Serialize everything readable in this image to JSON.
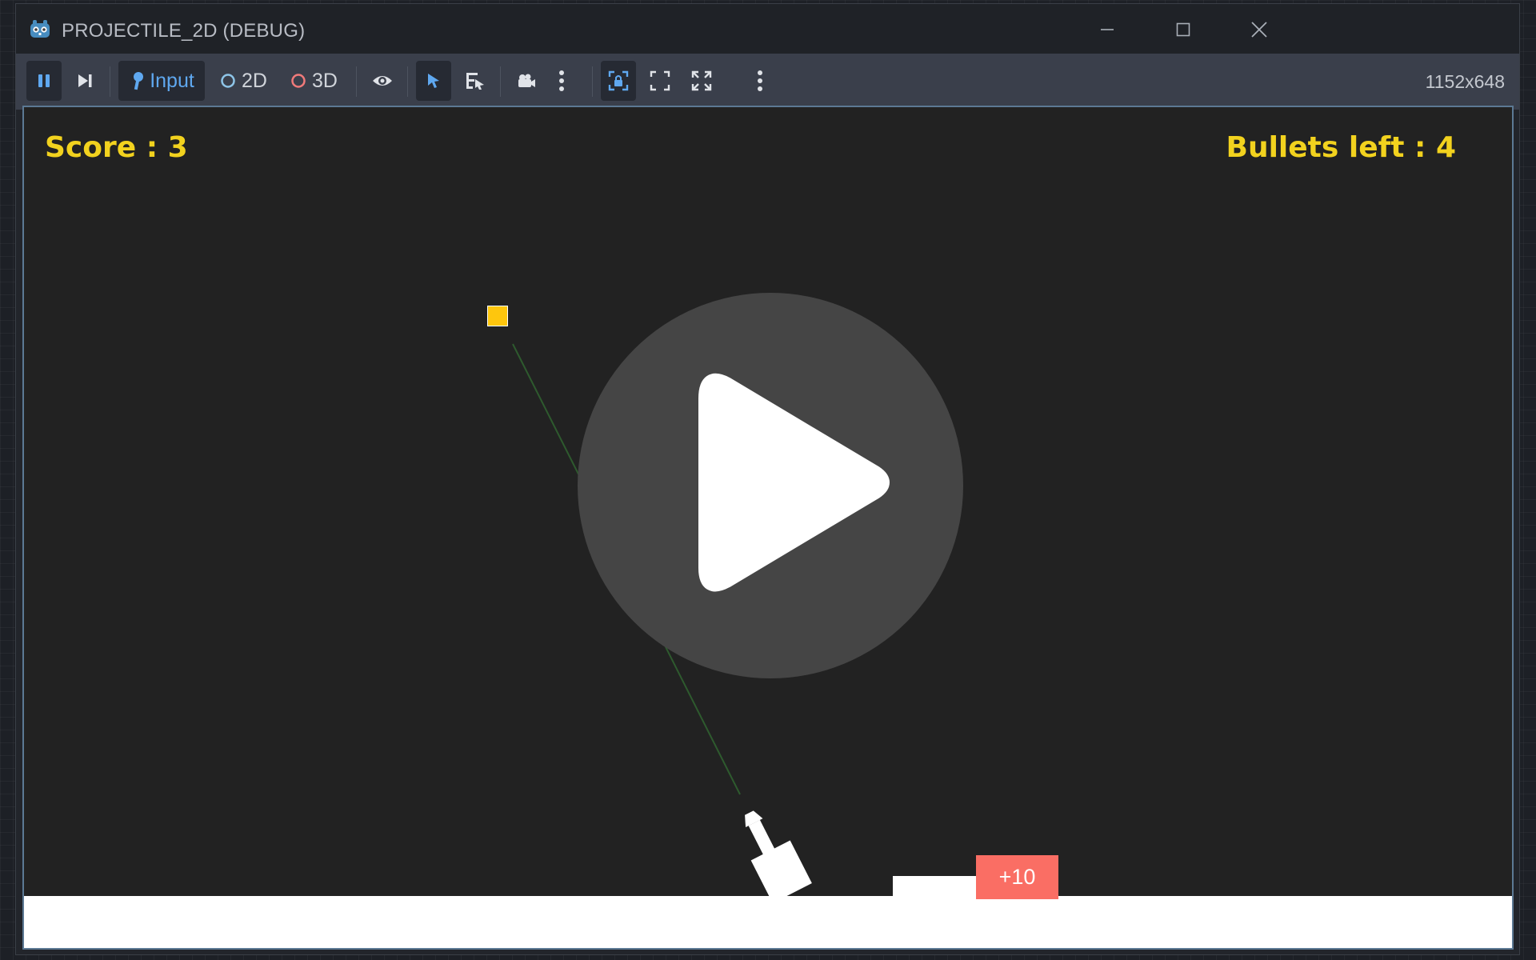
{
  "window": {
    "title": "PROJECTILE_2D (DEBUG)",
    "icons": {
      "app": "godot-icon",
      "minimize": "minimize-icon",
      "maximize": "maximize-icon",
      "close": "close-icon"
    }
  },
  "toolbar": {
    "pause_icon": "pause-icon",
    "step_icon": "step-frame-icon",
    "input_label": "Input",
    "mode_2d_label": "2D",
    "mode_3d_label": "3D",
    "resolution": "1152x648",
    "accent_color": "#5fa8f0"
  },
  "game": {
    "score_text": "Score : 3",
    "bullets_text": "Bullets left : 4",
    "target_label": "+10",
    "colors": {
      "hud": "#f2d21e",
      "bullet": "#fec60d",
      "target": "#fa6e64",
      "trajectory": "#2e5a2e",
      "background": "#222222"
    },
    "overlay_icon": "play-icon"
  }
}
